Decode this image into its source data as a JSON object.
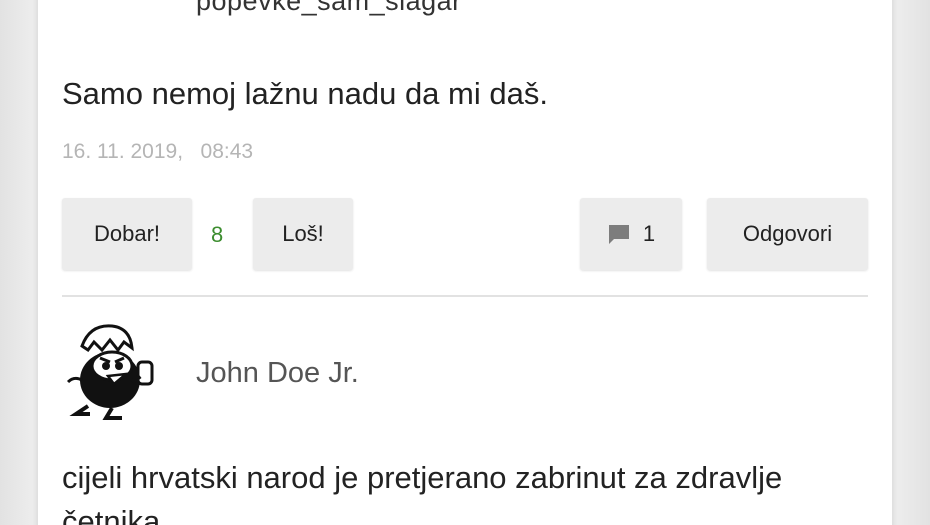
{
  "previous_comment": {
    "username_fragment": "popevke_sam_slagar"
  },
  "comment": {
    "text": "Samo nemoj lažnu nadu da mi daš.",
    "timestamp": "16. 11. 2019,   08:43",
    "good_label": "Dobar!",
    "score": "8",
    "score_color": "#3c8d2f",
    "bad_label": "Loš!",
    "replies_icon": "comment-bubble-icon",
    "replies_count": "1",
    "reply_label": "Odgovori"
  },
  "next_comment": {
    "author": "John Doe Jr.",
    "avatar_icon": "cartoon-chick-avatar",
    "text": "cijeli hrvatski narod je pretjerano zabrinut za zdravlje četnika"
  }
}
